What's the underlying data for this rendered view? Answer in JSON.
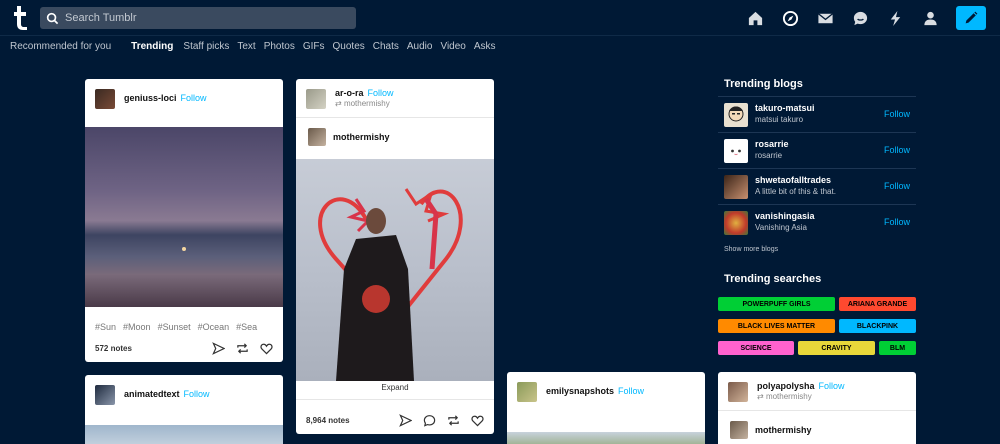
{
  "header": {
    "search_placeholder": "Search Tumblr",
    "icons": [
      "home-icon",
      "explore-icon",
      "inbox-icon",
      "messages-icon",
      "activity-icon",
      "account-icon",
      "compose-icon"
    ]
  },
  "nav": {
    "items": [
      "Recommended for you",
      "Trending",
      "Staff picks",
      "Text",
      "Photos",
      "GIFs",
      "Quotes",
      "Chats",
      "Audio",
      "Video",
      "Asks"
    ],
    "active": "Trending"
  },
  "posts": [
    {
      "username": "geniuss-loci",
      "follow": "Follow",
      "tags": [
        "#Sun",
        "#Moon",
        "#Sunset",
        "#Ocean",
        "#Sea"
      ],
      "notes": "572 notes"
    },
    {
      "username": "ar-o-ra",
      "follow": "Follow",
      "reblogged_from": "mothermishy",
      "inner_username": "mothermishy",
      "expand": "Expand",
      "notes": "8,964 notes"
    },
    {
      "username": "animatedtext",
      "follow": "Follow"
    },
    {
      "username": "emilysnapshots",
      "follow": "Follow"
    },
    {
      "username": "polyapolysha",
      "follow": "Follow",
      "reblogged_from": "mothermishy",
      "inner_username": "mothermishy"
    }
  ],
  "sidebar": {
    "trending_blogs_title": "Trending blogs",
    "blogs": [
      {
        "name": "takuro-matsui",
        "desc": "matsui takuro",
        "follow": "Follow"
      },
      {
        "name": "rosarrie",
        "desc": "rosarrie",
        "follow": "Follow"
      },
      {
        "name": "shwetaofalltrades",
        "desc": "A little bit of this & that.",
        "follow": "Follow"
      },
      {
        "name": "vanishingasia",
        "desc": "Vanishing Asia",
        "follow": "Follow"
      }
    ],
    "show_more": "Show more blogs",
    "trending_searches_title": "Trending searches",
    "searches": [
      {
        "label": "POWERPUFF GIRLS",
        "color": "#00cf35"
      },
      {
        "label": "ARIANA GRANDE",
        "color": "#ff492f"
      },
      {
        "label": "BLACK LIVES MATTER",
        "color": "#ff8a00"
      },
      {
        "label": "BLACKPINK",
        "color": "#00b8ff"
      },
      {
        "label": "SCIENCE",
        "color": "#ff62ce"
      },
      {
        "label": "CRAVITY",
        "color": "#e8d73a"
      },
      {
        "label": "BLM",
        "color": "#00cf35"
      }
    ]
  },
  "colors": {
    "background": "#001935",
    "accent": "#00b8ff"
  }
}
